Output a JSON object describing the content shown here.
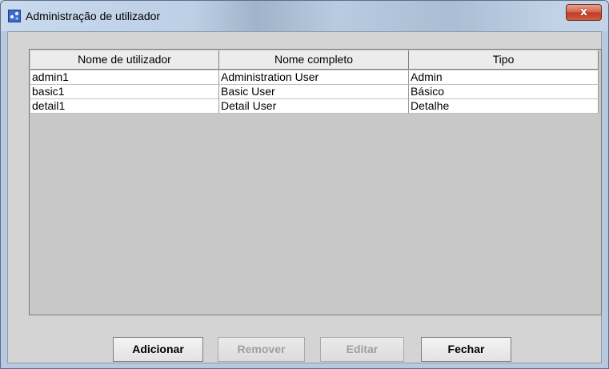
{
  "window": {
    "title": "Administração de utilizador",
    "close_label": "x"
  },
  "table": {
    "columns": [
      "Nome de utilizador",
      "Nome completo",
      "Tipo"
    ],
    "rows": [
      [
        "admin1",
        "Administration User",
        "Admin"
      ],
      [
        "basic1",
        "Basic User",
        "Básico"
      ],
      [
        "detail1",
        "Detail User",
        "Detalhe"
      ]
    ]
  },
  "buttons": {
    "add": "Adicionar",
    "remove": "Remover",
    "edit": "Editar",
    "close": "Fechar"
  },
  "colors": {
    "title_gradient": "#c3d4e8",
    "client_bg": "#d4d4d4",
    "close_red": "#c7432b"
  },
  "icons": {
    "app": "java-window-icon",
    "close": "close-icon"
  }
}
